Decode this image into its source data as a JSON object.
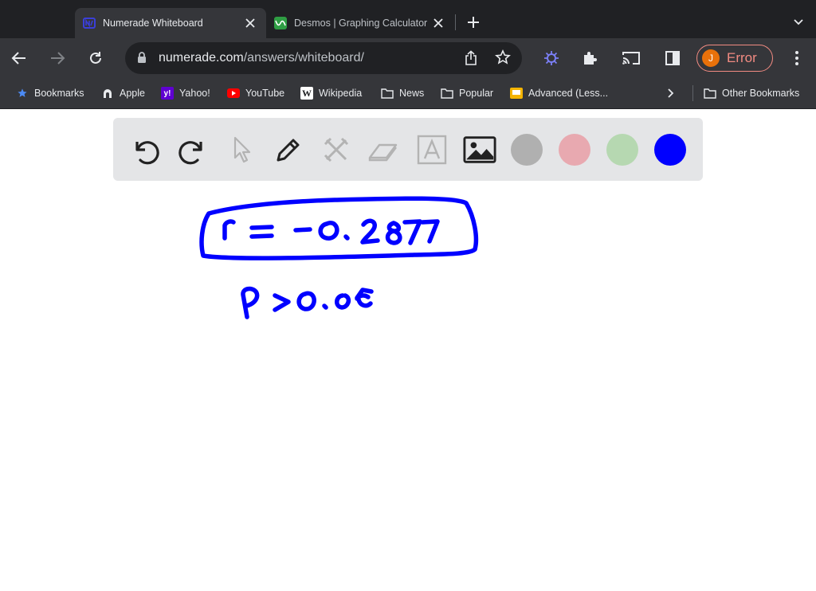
{
  "browser": {
    "tabs": [
      {
        "title": "Numerade Whiteboard",
        "active": true,
        "favicon": "numerade-icon"
      },
      {
        "title": "Desmos | Graphing Calculator",
        "active": false,
        "favicon": "desmos-icon"
      }
    ],
    "url_host": "numerade.com",
    "url_path": "/answers/whiteboard/",
    "profile": {
      "initial": "J",
      "status": "Error"
    },
    "bookmarks": [
      {
        "label": "Bookmarks",
        "icon": "star-icon"
      },
      {
        "label": "Apple",
        "icon": "apple-icon"
      },
      {
        "label": "Yahoo!",
        "icon": "yahoo-icon"
      },
      {
        "label": "YouTube",
        "icon": "youtube-icon"
      },
      {
        "label": "Wikipedia",
        "icon": "wikipedia-icon"
      },
      {
        "label": "News",
        "icon": "folder-icon"
      },
      {
        "label": "Popular",
        "icon": "folder-icon"
      },
      {
        "label": "Advanced (Less...",
        "icon": "advanced-icon"
      }
    ],
    "other_bookmarks": "Other Bookmarks"
  },
  "whiteboard": {
    "tools": [
      "undo-icon",
      "redo-icon",
      "pointer-icon",
      "pen-icon",
      "tools-icon",
      "eraser-icon",
      "text-icon",
      "image-icon"
    ],
    "colors": [
      "#b0b0b0",
      "#e8a9b0",
      "#b6d8b1",
      "#0000ff"
    ],
    "selected_color": "#0000ff",
    "ink_color": "#0000ff",
    "handwriting": [
      {
        "text": "r = -0.2877",
        "boxed": true
      },
      {
        "text": "p > 0.05",
        "boxed": false
      }
    ]
  }
}
